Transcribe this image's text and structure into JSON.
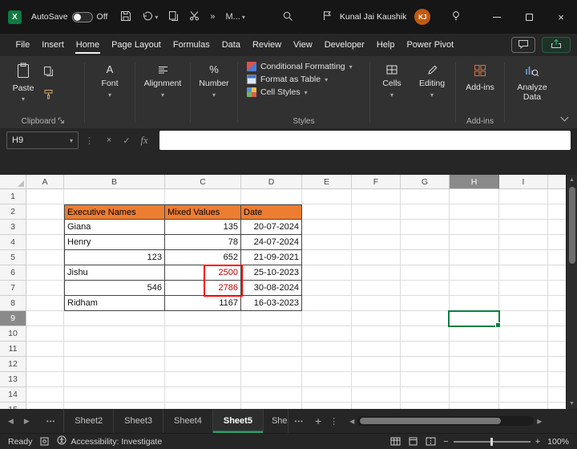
{
  "glyphs": {
    "chevron_down": "▾",
    "close": "×",
    "cancel": "×",
    "check": "✓",
    "dots_v": "⋮",
    "add": "+",
    "minus": "−",
    "plus": "+",
    "tab_prev": "◀",
    "tab_next": "▶",
    "scroll_up": "▲",
    "scroll_down": "▼",
    "font_icon": "A",
    "number_icon": "%"
  },
  "title_bar": {
    "app_logo": "X",
    "autosave_label": "AutoSave",
    "autosave_state": "Off",
    "quick_access": {
      "overflow": "»",
      "more_label": "M..."
    },
    "user": {
      "name": "Kunal Jai Kaushik",
      "initials": "KJ"
    }
  },
  "menu": {
    "items": [
      {
        "label": "File",
        "active": false
      },
      {
        "label": "Insert",
        "active": false
      },
      {
        "label": "Home",
        "active": true
      },
      {
        "label": "Page Layout",
        "active": false
      },
      {
        "label": "Formulas",
        "active": false
      },
      {
        "label": "Data",
        "active": false
      },
      {
        "label": "Review",
        "active": false
      },
      {
        "label": "View",
        "active": false
      },
      {
        "label": "Developer",
        "active": false
      },
      {
        "label": "Help",
        "active": false
      },
      {
        "label": "Power Pivot",
        "active": false
      }
    ]
  },
  "ribbon": {
    "paste": "Paste",
    "groups": {
      "clipboard": "Clipboard",
      "styles": "Styles",
      "addins": "Add-ins"
    },
    "collapsed": {
      "font": "Font",
      "alignment": "Alignment",
      "number": "Number",
      "cells": "Cells",
      "editing": "Editing"
    },
    "styles_buttons": {
      "conditional_formatting": "Conditional Formatting",
      "format_as_table": "Format as Table",
      "cell_styles": "Cell Styles"
    },
    "addins_button": "Add-ins",
    "analyze_data": "Analyze Data"
  },
  "formula_bar": {
    "name_box": "H9",
    "fx": "fx",
    "value": ""
  },
  "sheet": {
    "columns": [
      "A",
      "B",
      "C",
      "D",
      "E",
      "F",
      "G",
      "H",
      "I"
    ],
    "row_count": 15,
    "selected_cell": "H9",
    "selected_column": "H",
    "selected_row": "9",
    "table": {
      "headers": [
        "Executive Names",
        "Mixed Values",
        "Date"
      ],
      "rows": [
        {
          "name": "Giana",
          "name_align": "left",
          "value": "135",
          "value_red": false,
          "date": "20-07-2024"
        },
        {
          "name": "Henry",
          "name_align": "left",
          "value": "78",
          "value_red": false,
          "date": "24-07-2024"
        },
        {
          "name": "123",
          "name_align": "right",
          "value": "652",
          "value_red": false,
          "date": "21-09-2021"
        },
        {
          "name": "Jishu",
          "name_align": "left",
          "value": "2500",
          "value_red": true,
          "date": "25-10-2023"
        },
        {
          "name": "546",
          "name_align": "right",
          "value": "2786",
          "value_red": true,
          "date": "30-08-2024"
        },
        {
          "name": "Ridham",
          "name_align": "left",
          "value": "1167",
          "value_red": false,
          "date": "16-03-2023"
        }
      ]
    },
    "colors": {
      "table_header_bg": "#ED7D31",
      "red_text": "#C00000",
      "highlight_border": "#FF0000",
      "selection": "#107C41"
    }
  },
  "tabs": {
    "sheets": [
      {
        "label": "Sheet2",
        "active": false,
        "clipped": false
      },
      {
        "label": "Sheet3",
        "active": false,
        "clipped": false
      },
      {
        "label": "Sheet4",
        "active": false,
        "clipped": false
      },
      {
        "label": "Sheet5",
        "active": true,
        "clipped": false
      },
      {
        "label": "She",
        "active": false,
        "clipped": true
      }
    ],
    "overflow": "•••"
  },
  "status_bar": {
    "ready": "Ready",
    "accessibility": "Accessibility: Investigate",
    "zoom": "100%"
  }
}
